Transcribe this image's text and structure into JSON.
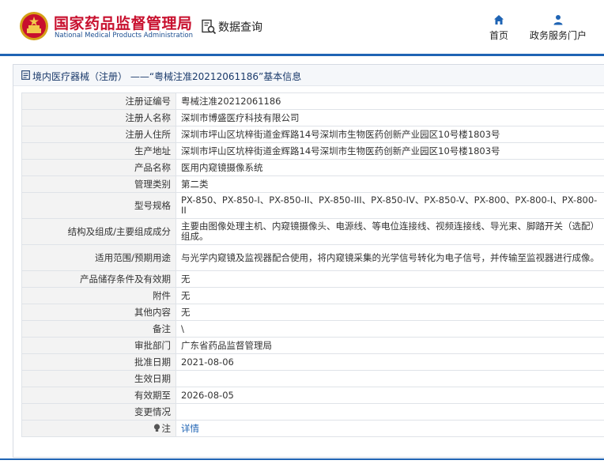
{
  "header": {
    "brand_cn": "国家药品监督管理局",
    "brand_en": "National Medical Products Administration",
    "query_label": "数据查询",
    "nav": {
      "home": "首页",
      "gov_service": "政务服务门户"
    }
  },
  "panel": {
    "title": "境内医疗器械（注册） ——“粤械注准20212061186”基本信息"
  },
  "rows": [
    {
      "label": "注册证编号",
      "value": "粤械注准20212061186"
    },
    {
      "label": "注册人名称",
      "value": "深圳市博盛医疗科技有限公司"
    },
    {
      "label": "注册人住所",
      "value": "深圳市坪山区坑梓街道金辉路14号深圳市生物医药创新产业园区10号楼1803号"
    },
    {
      "label": "生产地址",
      "value": "深圳市坪山区坑梓街道金辉路14号深圳市生物医药创新产业园区10号楼1803号"
    },
    {
      "label": "产品名称",
      "value": "医用内窥镜摄像系统"
    },
    {
      "label": "管理类别",
      "value": "第二类"
    },
    {
      "label": "型号规格",
      "value": "PX-850、PX-850-I、PX-850-II、PX-850-III、PX-850-IV、PX-850-V、PX-800、PX-800-I、PX-800-II"
    },
    {
      "label": "结构及组成/主要组成成分",
      "value": "主要由图像处理主机、内窥镜摄像头、电源线、等电位连接线、视频连接线、导光束、脚踏开关（选配）组成。"
    },
    {
      "label": "适用范围/预期用途",
      "value": "与光学内窥镜及监视器配合使用，将内窥镜采集的光学信号转化为电子信号，并传输至监视器进行成像。"
    },
    {
      "label": "产品储存条件及有效期",
      "value": "无"
    },
    {
      "label": "附件",
      "value": "无"
    },
    {
      "label": "其他内容",
      "value": "无"
    },
    {
      "label": "备注",
      "value": "\\"
    },
    {
      "label": "审批部门",
      "value": "广东省药品监督管理局"
    },
    {
      "label": "批准日期",
      "value": "2021-08-06"
    },
    {
      "label": "生效日期",
      "value": ""
    },
    {
      "label": "有效期至",
      "value": "2026-08-05"
    },
    {
      "label": "变更情况",
      "value": ""
    },
    {
      "label": "注",
      "value": "详情"
    }
  ],
  "colors": {
    "brand_red": "#c8102e",
    "brand_blue": "#1d4f91",
    "accent_blue": "#1f64b4",
    "label_bg": "#f3f3f3"
  }
}
